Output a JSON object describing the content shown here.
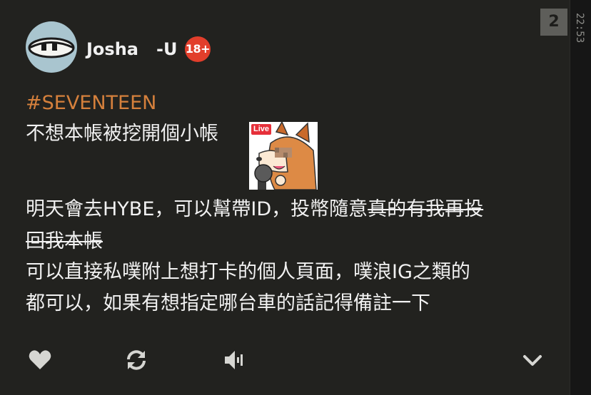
{
  "user": {
    "display_name": "Josha   -U",
    "age_badge": "18+"
  },
  "post": {
    "hashtag": "#SEVENTEEN",
    "line1": "不想本帳被挖開個小帳",
    "sticker_tag": "Live",
    "line2_normal": "明天會去HYBE，可以幫帶ID，投幣隨意",
    "line2_struck": "真的有我再投",
    "line3_struck": "回我本帳",
    "line4": "可以直接私噗附上想打卡的個人頁面，噗浪IG之類的",
    "line5": "都可以，如果有想指定哪台車的話記得備註一下"
  },
  "actions": {
    "like_icon": "heart-icon",
    "replurk_icon": "refresh-icon",
    "mute_icon": "speaker-icon",
    "expand_icon": "chevron-down-icon"
  },
  "meta": {
    "response_count": "2",
    "time": "22:53"
  },
  "colors": {
    "background": "#22221f",
    "hashtag": "#d5803c",
    "badge": "#e23e2b",
    "avatar_bg": "#a9c5cf"
  }
}
